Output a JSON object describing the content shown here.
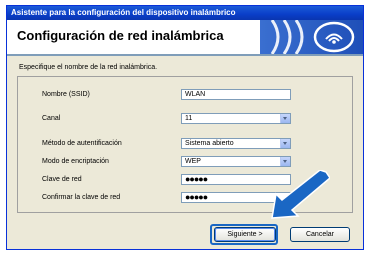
{
  "window": {
    "title": "Asistente para la configuración del dispositivo inalámbrico"
  },
  "header": {
    "title": "Configuración de red inalámbrica",
    "logo_icon": "wireless-signal-icon"
  },
  "intro_text": "Especifique el nombre de la red inalámbrica.",
  "form": {
    "ssid_label": "Nombre (SSID)",
    "ssid_value": "WLAN",
    "channel_label": "Canal",
    "channel_value": "11",
    "auth_label": "Método de autentificación",
    "auth_value": "Sistema abierto",
    "encryption_label": "Modo de encriptación",
    "encryption_value": "WEP",
    "key_label": "Clave de red",
    "key_value": "●●●●●",
    "confirm_key_label": "Confirmar la clave de red",
    "confirm_key_value": "●●●●●"
  },
  "buttons": {
    "next": "Siguiente >",
    "cancel": "Cancelar"
  },
  "colors": {
    "titlebar": "#0a3ec8",
    "dialog_bg": "#ece9d8",
    "arrow_callout": "#1a67c4"
  }
}
